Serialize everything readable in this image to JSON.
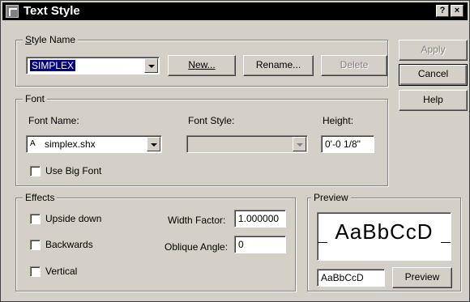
{
  "window": {
    "title": "Text Style",
    "help_button": "?",
    "close_button": "×"
  },
  "style_name": {
    "group_label": "Style Name",
    "selected_value": "SIMPLEX",
    "new_button": "New...",
    "rename_button": "Rename...",
    "delete_button": "Delete"
  },
  "side_buttons": {
    "apply": "Apply",
    "cancel": "Cancel",
    "help": "Help"
  },
  "font": {
    "group_label": "Font",
    "font_name_label": "Font Name:",
    "font_name_value": "simplex.shx",
    "font_icon": "A",
    "font_style_label": "Font Style:",
    "font_style_value": "",
    "height_label": "Height:",
    "height_value": "0'-0 1/8\"",
    "big_font_label": "Use Big Font",
    "big_font_checked": false
  },
  "effects": {
    "group_label": "Effects",
    "upside_down_label": "Upside down",
    "upside_down_checked": false,
    "backwards_label": "Backwards",
    "backwards_checked": false,
    "vertical_label": "Vertical",
    "vertical_checked": false,
    "width_factor_label": "Width Factor:",
    "width_factor_value": "1.000000",
    "oblique_angle_label": "Oblique Angle:",
    "oblique_angle_value": "0"
  },
  "preview": {
    "group_label": "Preview",
    "sample_text": "AaBbCcD",
    "input_value": "AaBbCcD",
    "preview_button": "Preview"
  }
}
